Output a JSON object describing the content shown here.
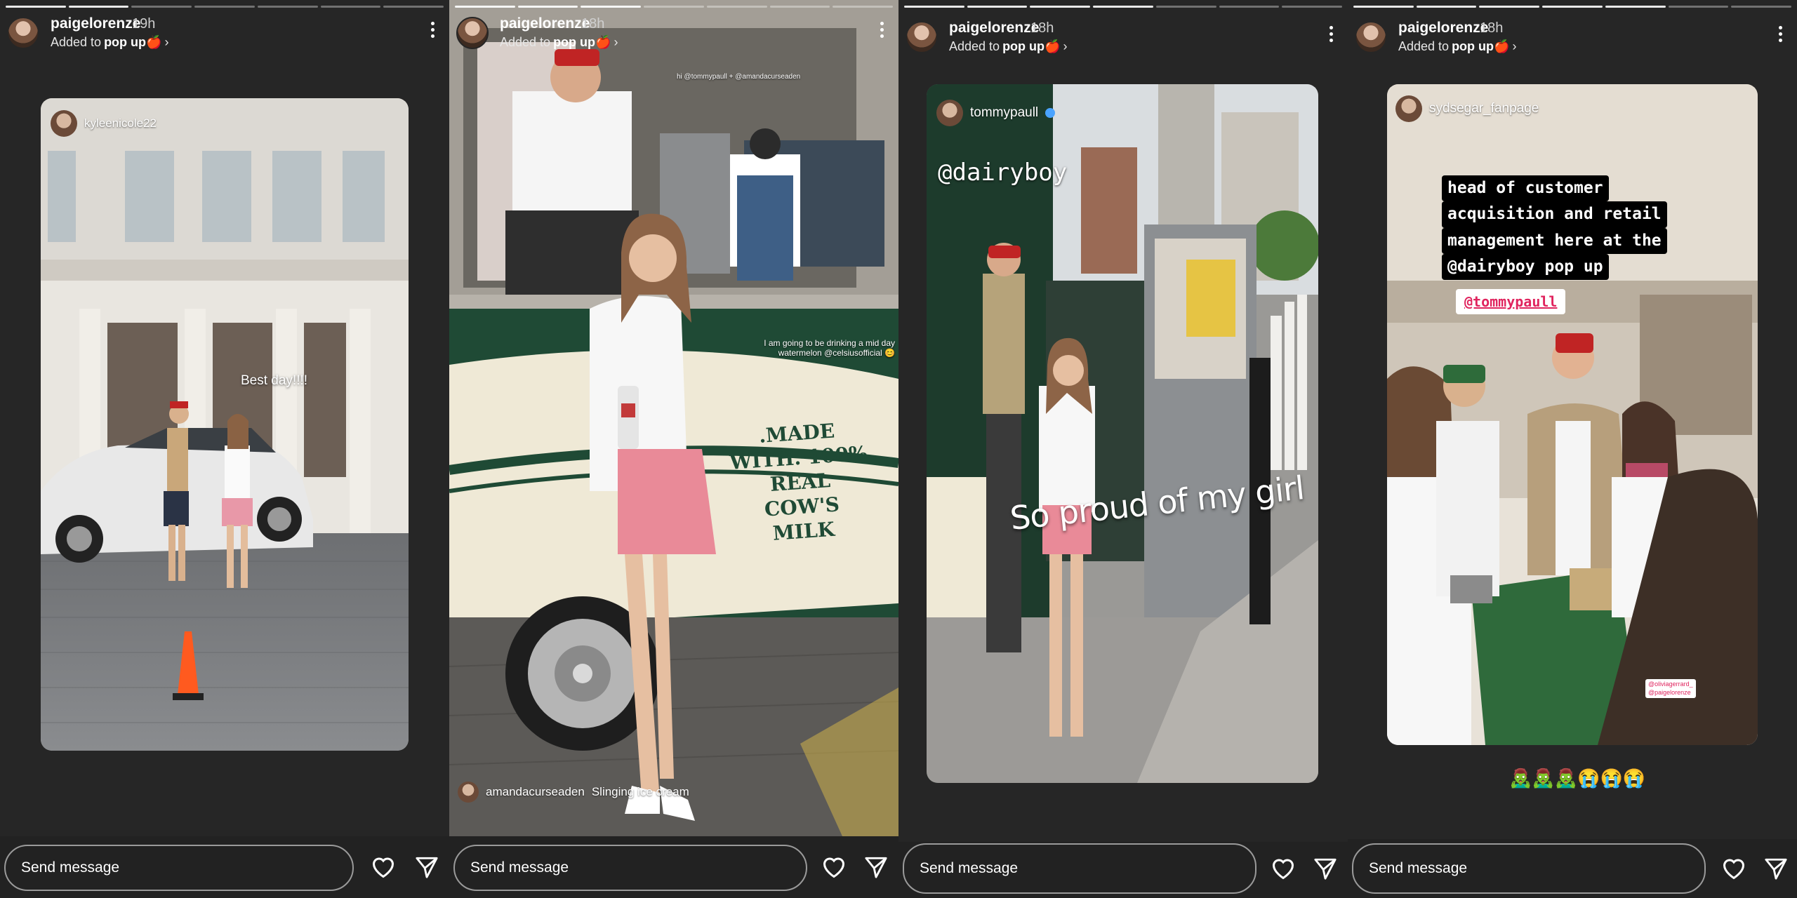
{
  "stories": [
    {
      "username": "paigelorenze",
      "time": "19h",
      "added_prefix": "Added to",
      "highlight": "pop up🍎",
      "tagged_user": "kyleenicole22",
      "caption": "Best day!!!!",
      "message_placeholder": "Send message"
    },
    {
      "username": "paigelorenze",
      "time": "18h",
      "added_prefix": "Added to",
      "highlight": "pop up🍎",
      "top_mention": "hi @tommypaull + @amandacurseaden",
      "side_text": "I am going to be drinking a mid day watermelon @celsiusofficial 😊",
      "truck_text": ".MADE WITH. 100% REAL COW'S MILK",
      "credit_user": "amandacurseaden",
      "credit_text": "Slinging ice cream",
      "message_placeholder": "Send message"
    },
    {
      "username": "paigelorenze",
      "time": "18h",
      "added_prefix": "Added to",
      "highlight": "pop up🍎",
      "tagged_user": "tommypaull",
      "mention": "@dairyboy",
      "caption": "So proud of my girl",
      "message_placeholder": "Send message"
    },
    {
      "username": "paigelorenze",
      "time": "18h",
      "added_prefix": "Added to",
      "highlight": "pop up🍎",
      "tagged_user": "sydsegar_fanpage",
      "lines": [
        "head of customer",
        "acquisition and retail",
        "management here at the",
        "@dairyboy pop up"
      ],
      "mention": "@tommypaull",
      "small_mentions": [
        "@oliviagerrard_",
        "@paigelorenze"
      ],
      "emoji_row": "🧟‍♂️🧟‍♂️🧟‍♂️😭😭😭",
      "message_placeholder": "Send message"
    }
  ],
  "icons": [
    "heart-icon",
    "send-icon",
    "more-icon",
    "chevron-right-icon"
  ],
  "colors": {
    "panel_bg": "#262626",
    "mention_red": "#e0245e",
    "truck_green": "#1f4a35",
    "truck_cream": "#efe9d6"
  }
}
